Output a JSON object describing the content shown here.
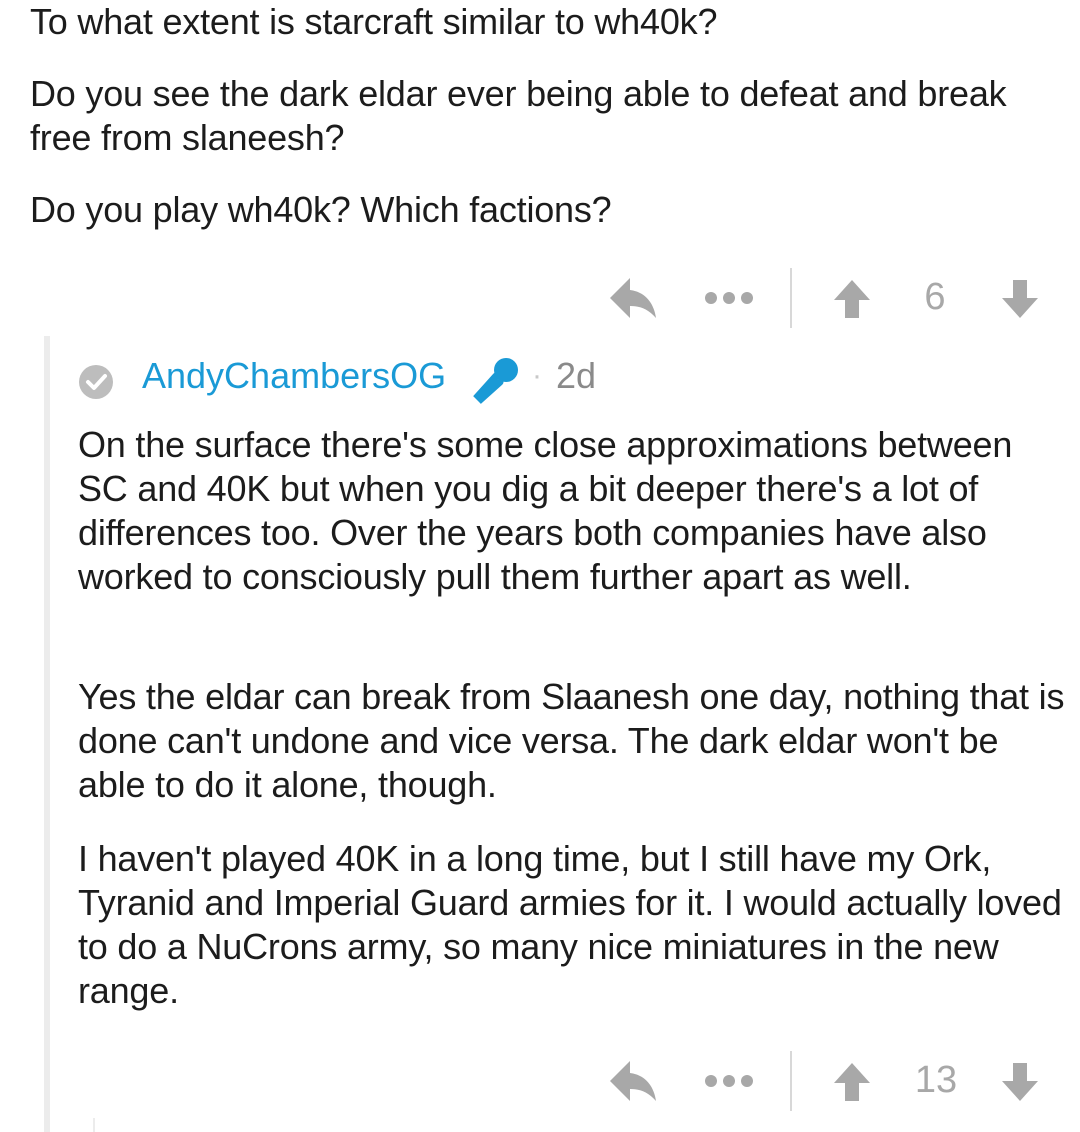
{
  "post": {
    "paragraphs": [
      "To what extent is starcraft similar to wh40k?",
      "Do you see the dark eldar ever being able to defeat and break free from slaneesh?",
      "Do you play wh40k? Which factions?"
    ],
    "score": "6"
  },
  "reply": {
    "username": "AndyChambersOG",
    "separator": "·",
    "age": "2d",
    "paragraphs": [
      "On the surface there's some close approximations between SC and 40K but when you dig a bit deeper there's a lot of differences too. Over the years both companies have also worked to consciously pull them further apart as well.",
      "Yes the eldar can break from Slaanesh one day, nothing that is done can't undone and vice versa. The dark eldar won't be able to do it alone, though.",
      "I haven't played 40K in a long time, but I still have my Ork, Tyranid and Imperial Guard armies for it. I would actually loved to do a NuCrons army, so many nice miniatures in the new range."
    ],
    "score": "13"
  },
  "icons": {
    "reply": "reply-arrow-icon",
    "more": "more-dots-icon",
    "upvote": "upvote-arrow-icon",
    "downvote": "downvote-arrow-icon",
    "user_check": "check-circle-icon",
    "flair": "microphone-icon"
  },
  "colors": {
    "text": "#1c1c1c",
    "icon": "#a8a8a8",
    "username": "#1a9ad6",
    "thread_line": "#ececec"
  }
}
